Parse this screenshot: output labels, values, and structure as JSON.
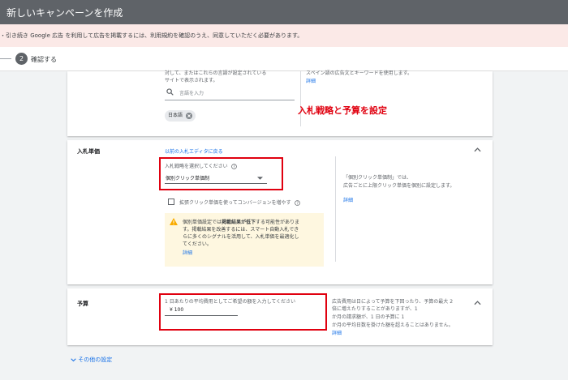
{
  "header": {
    "title": "新しいキャンペーンを作成"
  },
  "alert": {
    "message": "・引き続き Google 広告 を利用して広告を掲載するには、利用規約を確認のうえ、同意していただく必要があります。"
  },
  "stepper": {
    "step_number": "2",
    "step_label": "確認する"
  },
  "language_card": {
    "desc_line1": "対して、またはこれらの言語が設定されている",
    "desc_line2": "サイトで表示されます。",
    "search_placeholder": "言語を入力",
    "selected_chip": "日本語",
    "right_text": "スペイン語の広告文とキーワードを使用します。",
    "right_link": "詳細"
  },
  "bidding_card": {
    "title": "入札単価",
    "legacy_link": "以前の入札エディタに戻る",
    "strategy_label": "入札戦略を選択してください",
    "strategy_value": "個別クリック単価制",
    "enhanced_cpc_label": "拡張クリック単価を使ってコンバージョンを増やす",
    "warning_line1": "個別単価設定では",
    "warning_bold": "掲載結果が低下",
    "warning_line1b": "する可能性がありま",
    "warning_line2": "す。掲載結果を改善するには、スマート自動入札でき",
    "warning_line3": "らに多くのシグナルを活用して、入札単価を最適化し",
    "warning_line4": "てください。",
    "warning_link": "詳細",
    "side_line1": "「個別クリック単価制」では、",
    "side_line2": "広告ごとに上限クリック単価を個別に設定します。",
    "side_link": "詳細",
    "annotation": "入札戦略と予算を設定"
  },
  "budget_card": {
    "title": "予算",
    "prompt": "1 日あたりの平均費用としてご希望の額を入力してください",
    "value": "¥ 100",
    "side_line1": "広告費用は日によって予算を下回ったり、予算の最大 2",
    "side_line2": "倍に増えたりすることがありますが、1",
    "side_line3": "か月の請求額が、1 日の予算に 1",
    "side_line4": "か月の平均日数を掛けた額を超えることはありません。",
    "side_link": "詳細"
  },
  "footer": {
    "more_settings": "その他の設定"
  },
  "colors": {
    "accent": "#1a73e8",
    "annotation_red": "#e0000f",
    "topbar": "#5f6368",
    "alert_bg": "#fbe9e7"
  },
  "icons": {
    "search": "search-icon",
    "remove": "close-icon",
    "help": "help-icon",
    "warning": "warning-icon",
    "collapse": "chevron-up-icon",
    "expand": "chevron-down-icon",
    "dropdown": "caret-down-icon"
  }
}
